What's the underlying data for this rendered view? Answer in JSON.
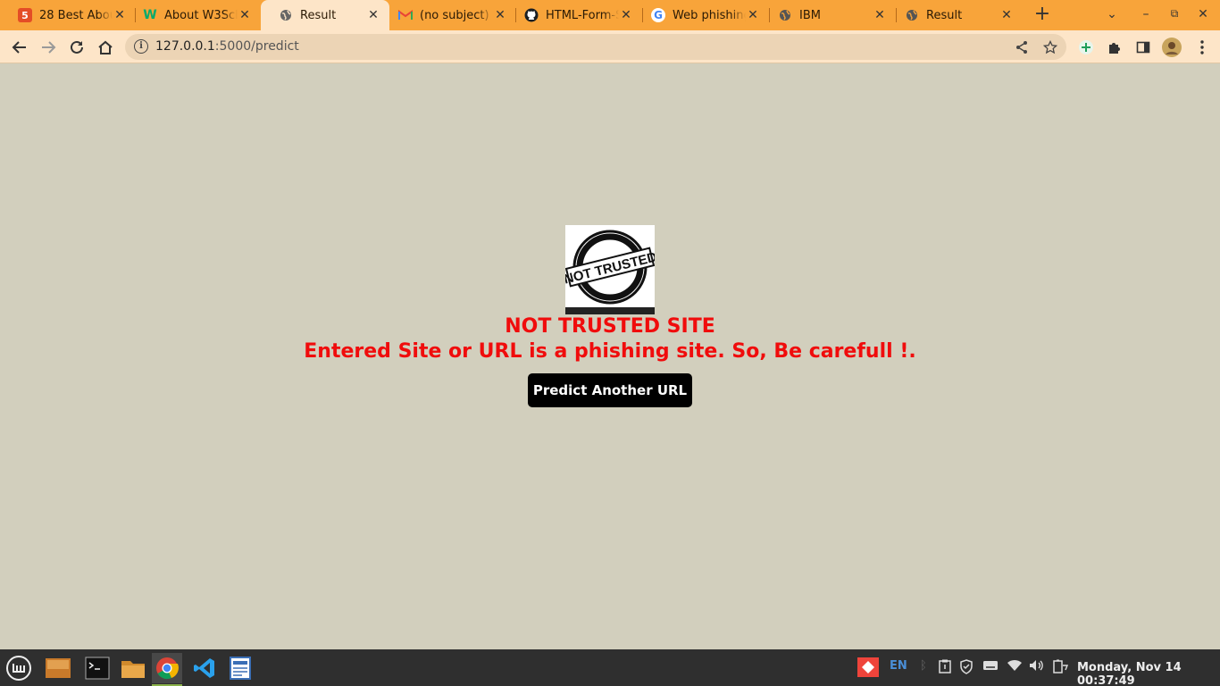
{
  "browser": {
    "tabs": [
      {
        "title": "28 Best Abou",
        "icon": "html5-icon",
        "active": false
      },
      {
        "title": "About W3Sch",
        "icon": "w3schools-icon",
        "active": false
      },
      {
        "title": "Result",
        "icon": "globe-icon",
        "active": true
      },
      {
        "title": "(no subject) - ",
        "icon": "gmail-icon",
        "active": false
      },
      {
        "title": "HTML-Form-S",
        "icon": "github-icon",
        "active": false
      },
      {
        "title": "Web phishing",
        "icon": "google-icon",
        "active": false
      },
      {
        "title": "IBM",
        "icon": "globe-icon",
        "active": false
      },
      {
        "title": "Result",
        "icon": "globe-icon",
        "active": false
      }
    ],
    "url_host": "127.0.0.1",
    "url_rest": ":5000/predict"
  },
  "page": {
    "logo_text": "NOT TRUSTED",
    "headline": "NOT TRUSTED SITE",
    "message": "Entered Site or URL is a phishing site. So, Be carefull !.",
    "button_label": "Predict Another URL",
    "accent_color": "#f00c0c"
  },
  "taskbar": {
    "keyboard_layout": "EN",
    "clock": "Monday, Nov 14 00:37:49"
  }
}
